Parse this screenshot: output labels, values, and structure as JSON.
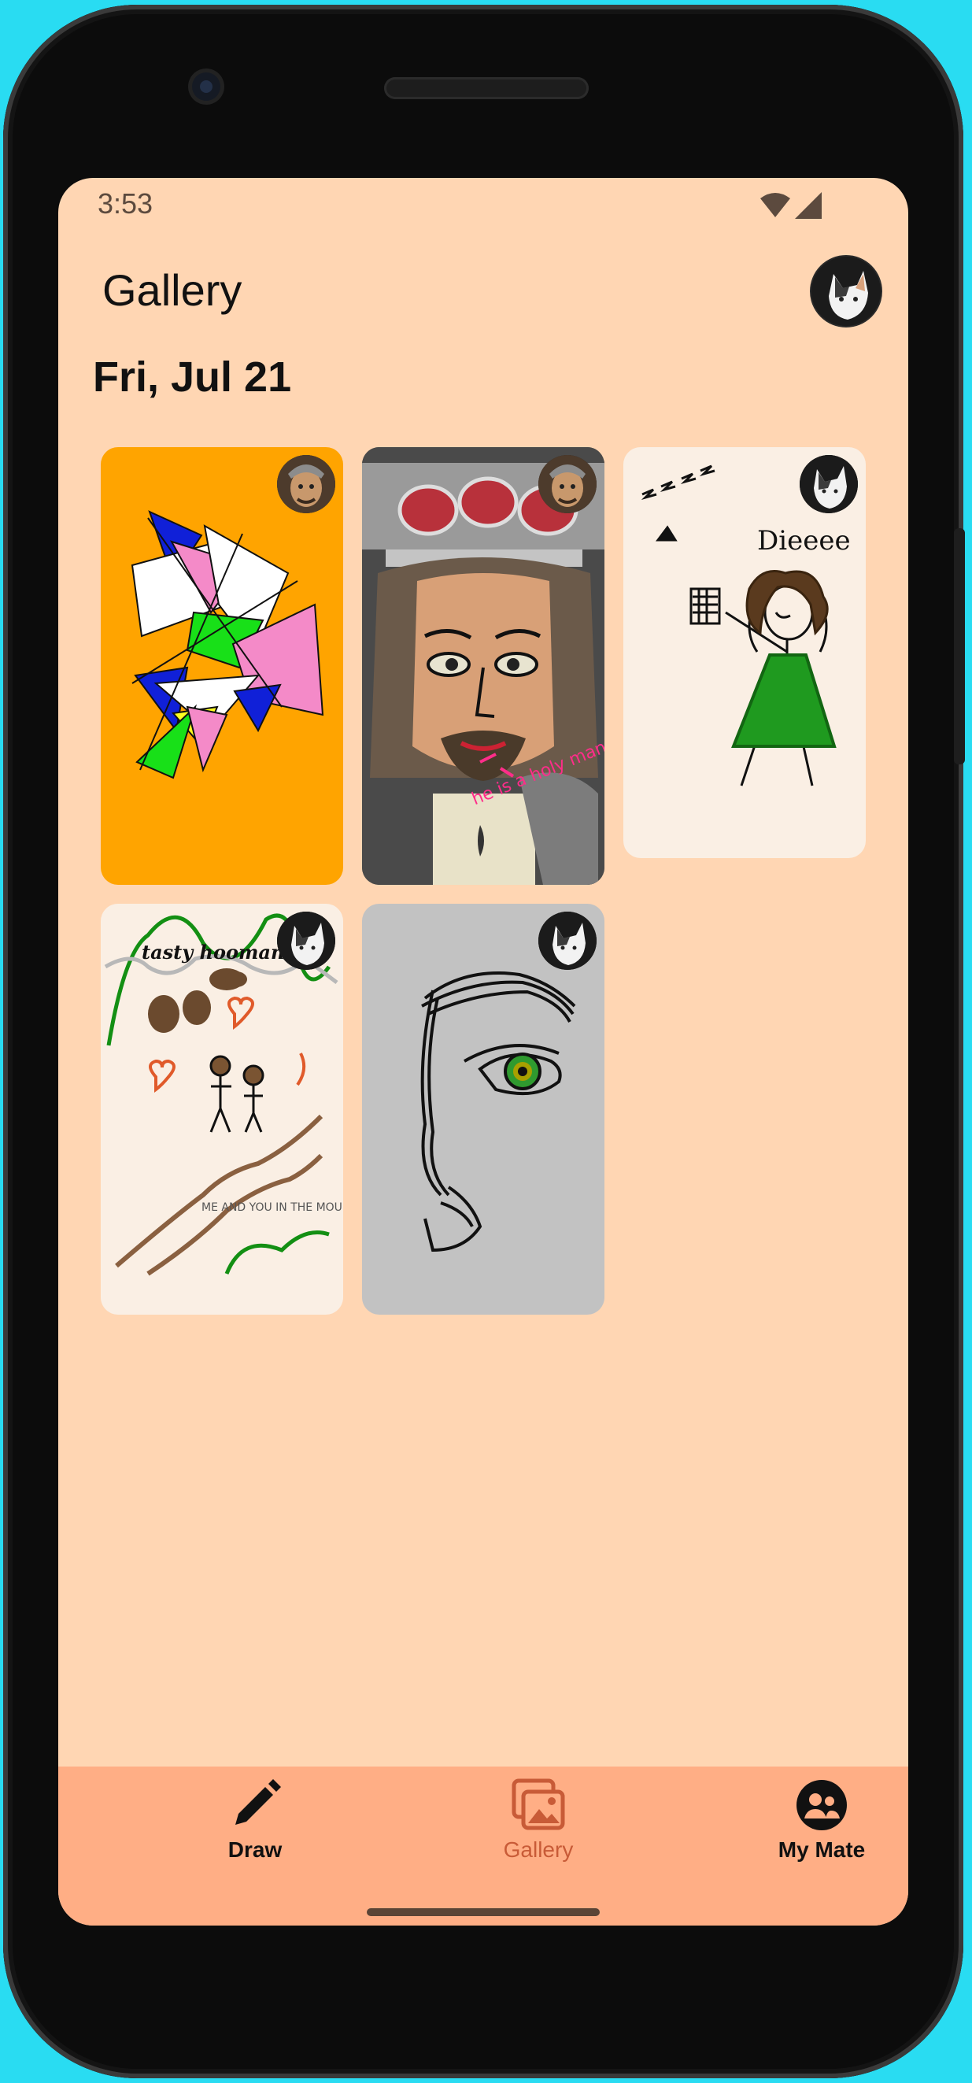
{
  "status_bar": {
    "time": "3:53"
  },
  "header": {
    "title": "Gallery",
    "profile_avatar": "user-avatar-cat"
  },
  "gallery": {
    "date": "Fri, Jul 21",
    "items": [
      {
        "name": "geometric-abstract-drawing",
        "author_avatar": "user-avatar-portrait"
      },
      {
        "name": "sculpture-photo-drawing",
        "caption": "he is a holy man with a mission",
        "author_avatar": "user-avatar-portrait"
      },
      {
        "name": "stick-figure-green-dress-drawing",
        "caption": "Dieeee",
        "author_avatar": "user-avatar-cat"
      },
      {
        "name": "mountains-couple-drawing",
        "caption": "tasty hoomans",
        "caption2": "ME AND YOU IN THE MOUNTAINS",
        "author_avatar": "user-avatar-cat"
      },
      {
        "name": "eye-sketch-drawing",
        "author_avatar": "user-avatar-cat"
      }
    ]
  },
  "bottom_nav": {
    "items": [
      {
        "label": "Draw",
        "icon": "pencil-icon",
        "active": false
      },
      {
        "label": "Gallery",
        "icon": "gallery-icon",
        "active": true
      },
      {
        "label": "My Mate",
        "icon": "people-icon",
        "active": false
      }
    ]
  },
  "colors": {
    "background": "#ffd6b3",
    "nav_background": "#ffae85",
    "active": "#c85b37",
    "frame": "#29dcf2"
  }
}
